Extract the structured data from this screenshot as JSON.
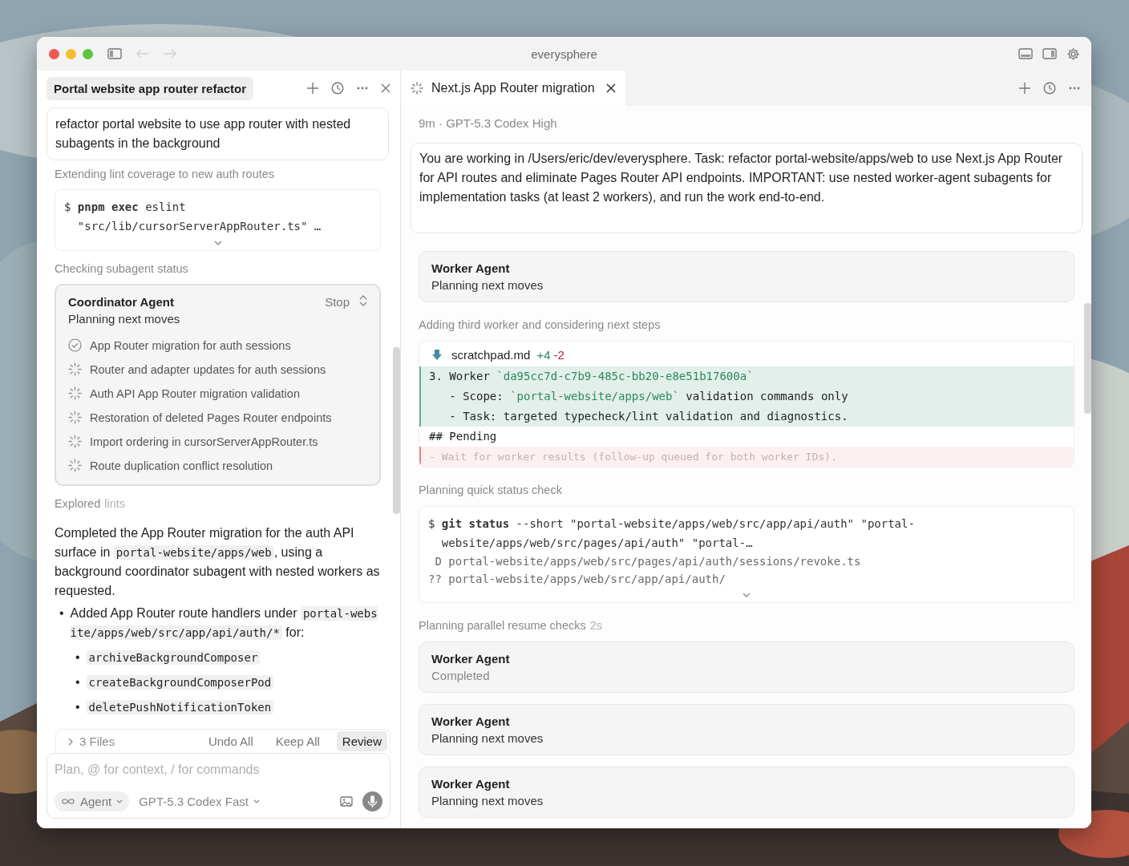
{
  "window": {
    "title": "everysphere"
  },
  "panes": [
    {
      "kind": "chat",
      "tab": {
        "title": "Portal website app router refactor"
      },
      "prompt": "refactor portal website to use app router with nested subagents in the background",
      "feed": [
        {
          "kind": "status",
          "text": "Extending lint coverage to new auth routes"
        },
        {
          "kind": "command",
          "lines": [
            "$ **pnpm exec** eslint",
            "  \"src/lib/cursorServerAppRouter.ts\" …"
          ]
        },
        {
          "kind": "status",
          "text": "Checking subagent status"
        },
        {
          "kind": "agent",
          "name": "Coordinator Agent",
          "status": "Planning next moves",
          "completed": false,
          "action": "Stop",
          "tasks": [
            {
              "label": "App Router migration for auth sessions",
              "done": true
            },
            {
              "label": "Router and adapter updates for auth sessions",
              "done": false
            },
            {
              "label": "Auth API App Router migration validation",
              "done": false
            },
            {
              "label": "Restoration of deleted Pages Router endpoints",
              "done": false
            },
            {
              "label": "Import ordering in cursorServerAppRouter.ts",
              "done": false
            },
            {
              "label": "Route duplication conflict resolution",
              "done": false
            }
          ]
        },
        {
          "kind": "status",
          "text": "Explored",
          "detail": "lints"
        },
        {
          "kind": "message",
          "segments": [
            {
              "text": "Completed the App Router migration for the auth API surface in ",
              "code": false
            },
            {
              "text": "portal-website/apps/web",
              "code": true
            },
            {
              "text": ", using a background coordinator subagent with nested workers as requested.",
              "code": false
            }
          ],
          "bullets": [
            {
              "marker": "•",
              "segments": [
                {
                  "text": "Added App Router route handlers under ",
                  "code": false
                },
                {
                  "text": "portal-website/apps/web/src/app/api/auth/*",
                  "code": true
                },
                {
                  "text": " for:",
                  "code": false
                }
              ],
              "children": [
                {
                  "marker": "•",
                  "segments": [
                    {
                      "text": "archiveBackgroundComposer",
                      "code": true
                    }
                  ]
                },
                {
                  "marker": "•",
                  "segments": [
                    {
                      "text": "createBackgroundComposerPod",
                      "code": true
                    }
                  ]
                },
                {
                  "marker": "•",
                  "segments": [
                    {
                      "text": "deletePushNotificationToken",
                      "code": true
                    }
                  ]
                }
              ]
            }
          ]
        }
      ],
      "files_bar": {
        "count": "3 Files",
        "actions": [
          {
            "label": "Undo All",
            "primary": false
          },
          {
            "label": "Keep All",
            "primary": false
          },
          {
            "label": "Review",
            "primary": true
          }
        ]
      },
      "composer": {
        "placeholder": "Plan, @ for context, / for commands",
        "mode": "Agent",
        "model": "GPT-5.3 Codex Fast"
      }
    },
    {
      "kind": "tabbed",
      "tab": {
        "title": "Next.js App Router migration"
      },
      "meta": "9m · GPT-5.3 Codex High",
      "prompt": "You are working in /Users/eric/dev/everysphere. Task: refactor portal-website/apps/web to use Next.js App Router for API routes and eliminate Pages Router API endpoints. IMPORTANT: use nested worker-agent subagents for implementation tasks (at least 2 workers), and run the work end-to-end.",
      "feed": [
        {
          "kind": "agent",
          "name": "Worker Agent",
          "status": "Planning next moves",
          "completed": false
        },
        {
          "kind": "status",
          "text": "Adding third worker and considering next steps"
        },
        {
          "kind": "diff",
          "file": "scratchpad.md",
          "added": "+4",
          "removed": "-2",
          "lines": [
            {
              "kind": "added",
              "segments": [
                {
                  "text": "3. Worker ",
                  "code": false
                },
                {
                  "text": "`da95cc7d-c7b9-485c-bb20-e8e51b17600a`",
                  "code": true
                }
              ]
            },
            {
              "kind": "added",
              "segments": [
                {
                  "text": "   - Scope: ",
                  "code": false
                },
                {
                  "text": "`portal-website/apps/web`",
                  "code": true
                },
                {
                  "text": " validation commands only",
                  "code": false
                }
              ]
            },
            {
              "kind": "added",
              "segments": [
                {
                  "text": "   - Task: targeted typecheck/lint validation and diagnostics.",
                  "code": false
                }
              ]
            },
            {
              "kind": "context",
              "segments": [
                {
                  "text": "## Pending",
                  "code": false
                }
              ]
            },
            {
              "kind": "removed",
              "segments": [
                {
                  "text": "- Wait for worker results (follow-up queued for both worker IDs).",
                  "code": false
                }
              ]
            }
          ]
        },
        {
          "kind": "status",
          "text": "Planning quick status check"
        },
        {
          "kind": "command",
          "lines": [
            "$ **git status** --short \"portal-website/apps/web/src/app/api/auth\" \"portal-",
            "  website/apps/web/src/pages/api/auth\" \"portal-…"
          ],
          "output": [
            " D portal-website/apps/web/src/pages/api/auth/sessions/revoke.ts",
            "?? portal-website/apps/web/src/app/api/auth/"
          ]
        },
        {
          "kind": "status",
          "text": "Planning parallel resume checks",
          "detail": "2s"
        },
        {
          "kind": "agent",
          "name": "Worker Agent",
          "status": "Completed",
          "completed": true
        },
        {
          "kind": "agent",
          "name": "Worker Agent",
          "status": "Planning next moves",
          "completed": false
        },
        {
          "kind": "agent",
          "name": "Worker Agent",
          "status": "Planning next moves",
          "completed": false
        }
      ]
    }
  ]
}
